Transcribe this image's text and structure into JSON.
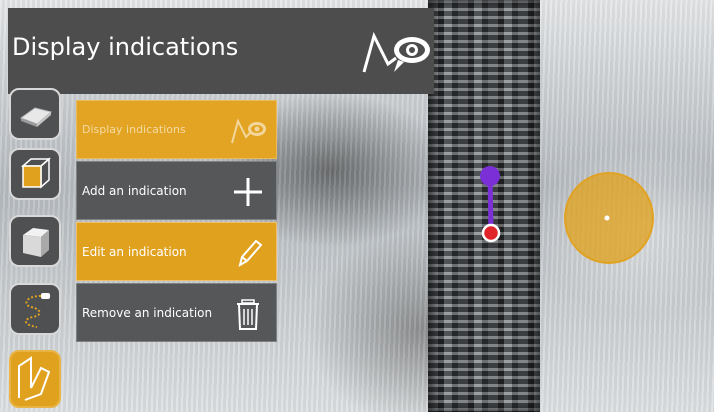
{
  "header": {
    "title": "Display indications",
    "icon": "display-indications-eye-icon"
  },
  "colors": {
    "accent": "#e0a11f",
    "panel": "#4d4d4d",
    "menu_bg": "#565758",
    "marker_purple": "#7b2fd6",
    "marker_red": "#e0252b"
  },
  "tools": [
    {
      "icon": "surface-plate-icon"
    },
    {
      "icon": "cube-orange-face-icon"
    },
    {
      "icon": "cube-white-icon"
    },
    {
      "icon": "path-trace-icon"
    },
    {
      "icon": "indications-tool-icon",
      "active": true
    }
  ],
  "menu": {
    "items": [
      {
        "label": "Display indications",
        "icon": "display-indications-eye-icon",
        "state": "disabled"
      },
      {
        "label": "Add an indication",
        "icon": "plus-icon",
        "state": "normal"
      },
      {
        "label": "Edit an indication",
        "icon": "pencil-icon",
        "state": "selected"
      },
      {
        "label": "Remove an indication",
        "icon": "trash-icon",
        "state": "normal"
      }
    ]
  }
}
